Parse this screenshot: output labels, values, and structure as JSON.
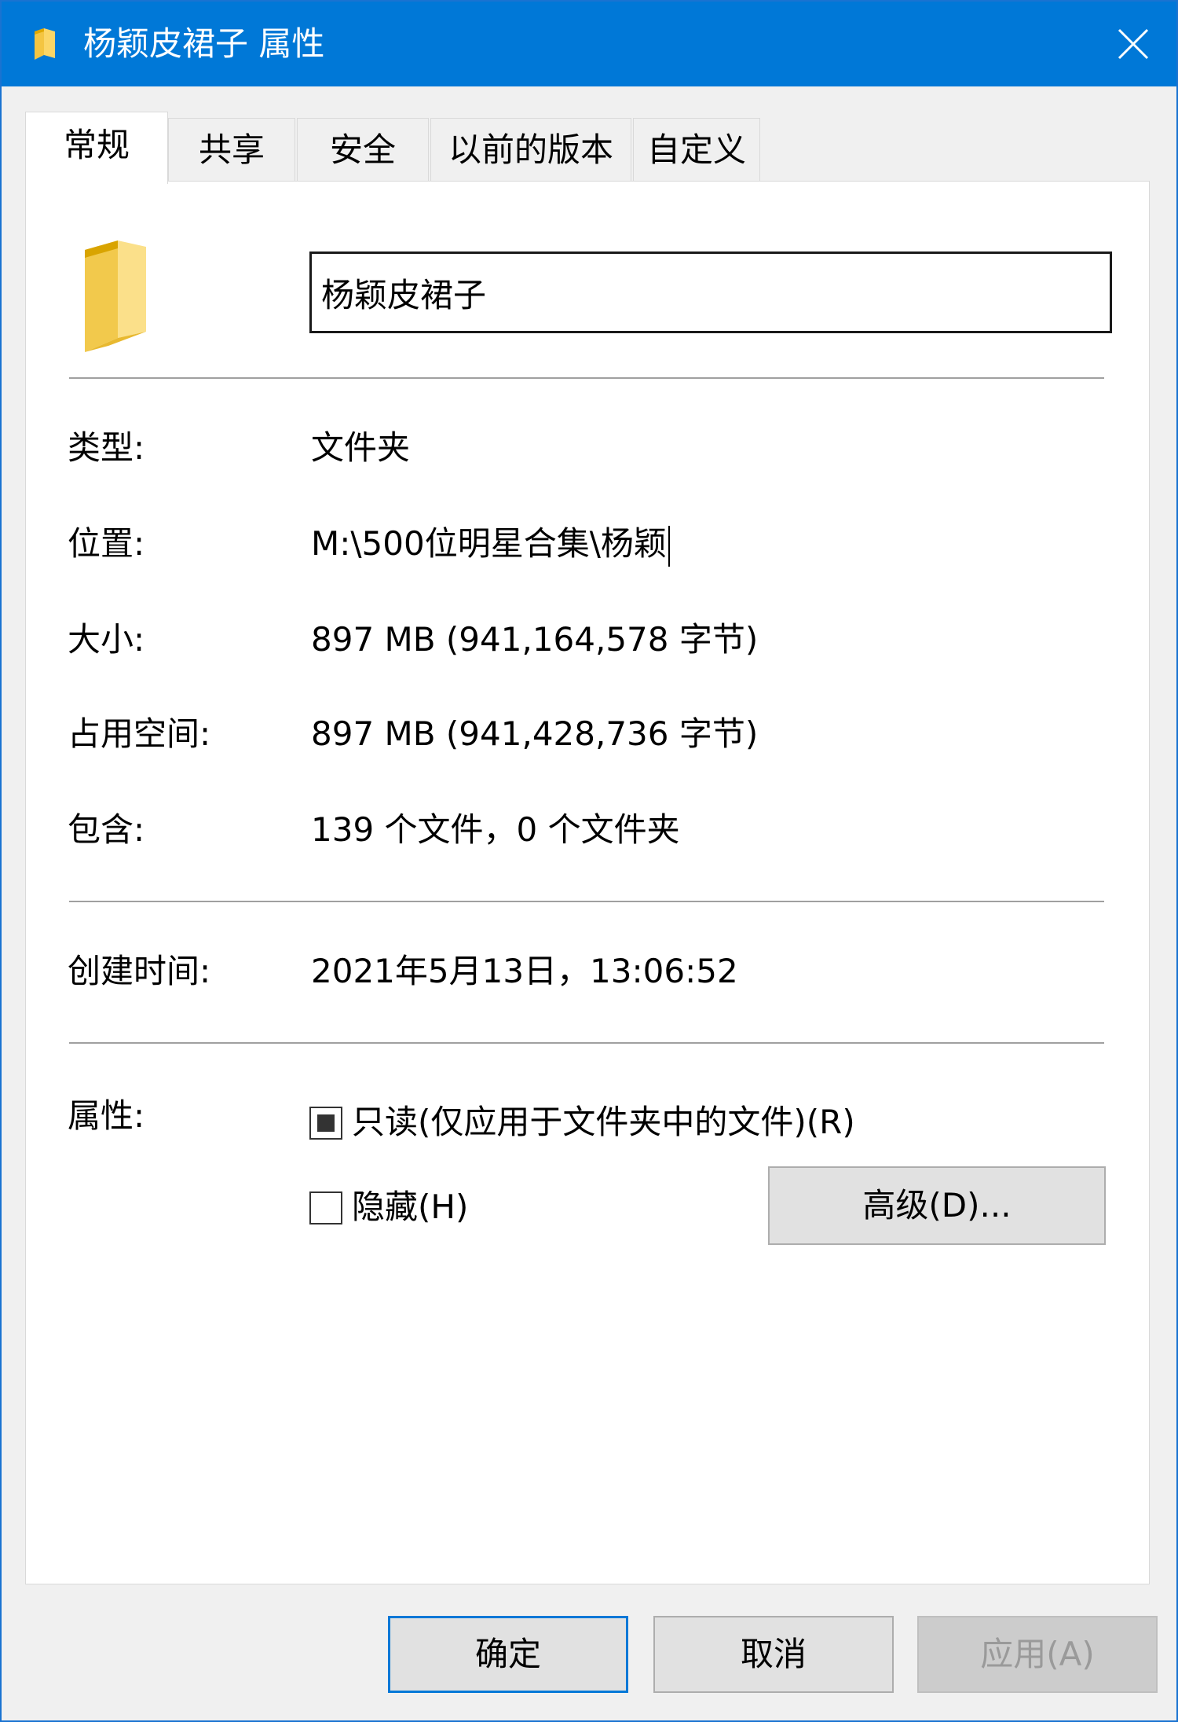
{
  "window": {
    "title": "杨颖皮裙子 属性"
  },
  "tabs": [
    {
      "label": "常规",
      "active": true
    },
    {
      "label": "共享",
      "active": false
    },
    {
      "label": "安全",
      "active": false
    },
    {
      "label": "以前的版本",
      "active": false
    },
    {
      "label": "自定义",
      "active": false
    }
  ],
  "general": {
    "name_value": "杨颖皮裙子",
    "rows": {
      "type": {
        "label": "类型:",
        "value": "文件夹"
      },
      "location": {
        "label": "位置:",
        "value": "M:\\500位明星合集\\杨颖"
      },
      "size": {
        "label": "大小:",
        "value": "897 MB (941,164,578 字节)"
      },
      "size_on_disk": {
        "label": "占用空间:",
        "value": "897 MB (941,428,736 字节)"
      },
      "contains": {
        "label": "包含:",
        "value": "139 个文件，0 个文件夹"
      },
      "created": {
        "label": "创建时间:",
        "value": "2021年5月13日，13:06:52"
      }
    },
    "attributes": {
      "label": "属性:",
      "readonly_label": "只读(仅应用于文件夹中的文件)(R)",
      "readonly_state": "indeterminate",
      "hidden_label": "隐藏(H)",
      "hidden_state": "unchecked",
      "advanced_button": "高级(D)..."
    }
  },
  "footer": {
    "ok": "确定",
    "cancel": "取消",
    "apply": "应用(A)"
  },
  "colors": {
    "titlebar": "#0078d7",
    "folder": "#f2c94c",
    "primary_border": "#0078d7"
  },
  "icons": {
    "title_icon": "folder-icon",
    "close": "close-icon",
    "big_icon": "folder-icon"
  }
}
